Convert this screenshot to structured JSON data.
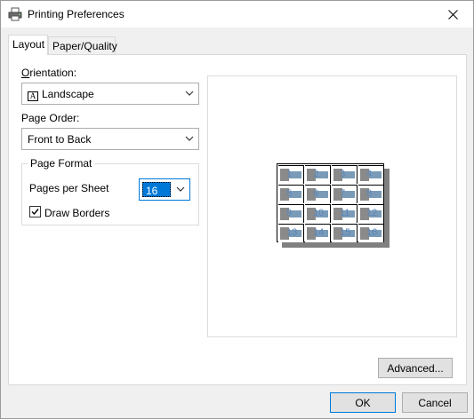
{
  "window": {
    "title": "Printing Preferences",
    "icon": "printer-icon",
    "close_icon": "close-icon"
  },
  "tabs": [
    {
      "label": "Layout",
      "active": true
    },
    {
      "label": "Paper/Quality",
      "active": false
    }
  ],
  "layout": {
    "orientation_label": "Orientation:",
    "orientation_value": "Landscape",
    "orientation_icon_glyph": "A",
    "page_order_label": "Page Order:",
    "page_order_value": "Front to Back",
    "page_format_title": "Page Format",
    "pages_per_sheet_label": "Pages per Sheet",
    "pages_per_sheet_value": "16",
    "draw_borders_label": "Draw Borders",
    "draw_borders_checked": true
  },
  "preview": {
    "page_numbers": [
      "1",
      "2",
      "3",
      "4",
      "5",
      "6",
      "7",
      "8",
      "9",
      "10",
      "11",
      "12",
      "13",
      "14",
      "15",
      "16"
    ]
  },
  "buttons": {
    "advanced": "Advanced...",
    "ok": "OK",
    "cancel": "Cancel"
  },
  "colors": {
    "accent": "#0078d7",
    "page_number": "#5c86b8"
  }
}
